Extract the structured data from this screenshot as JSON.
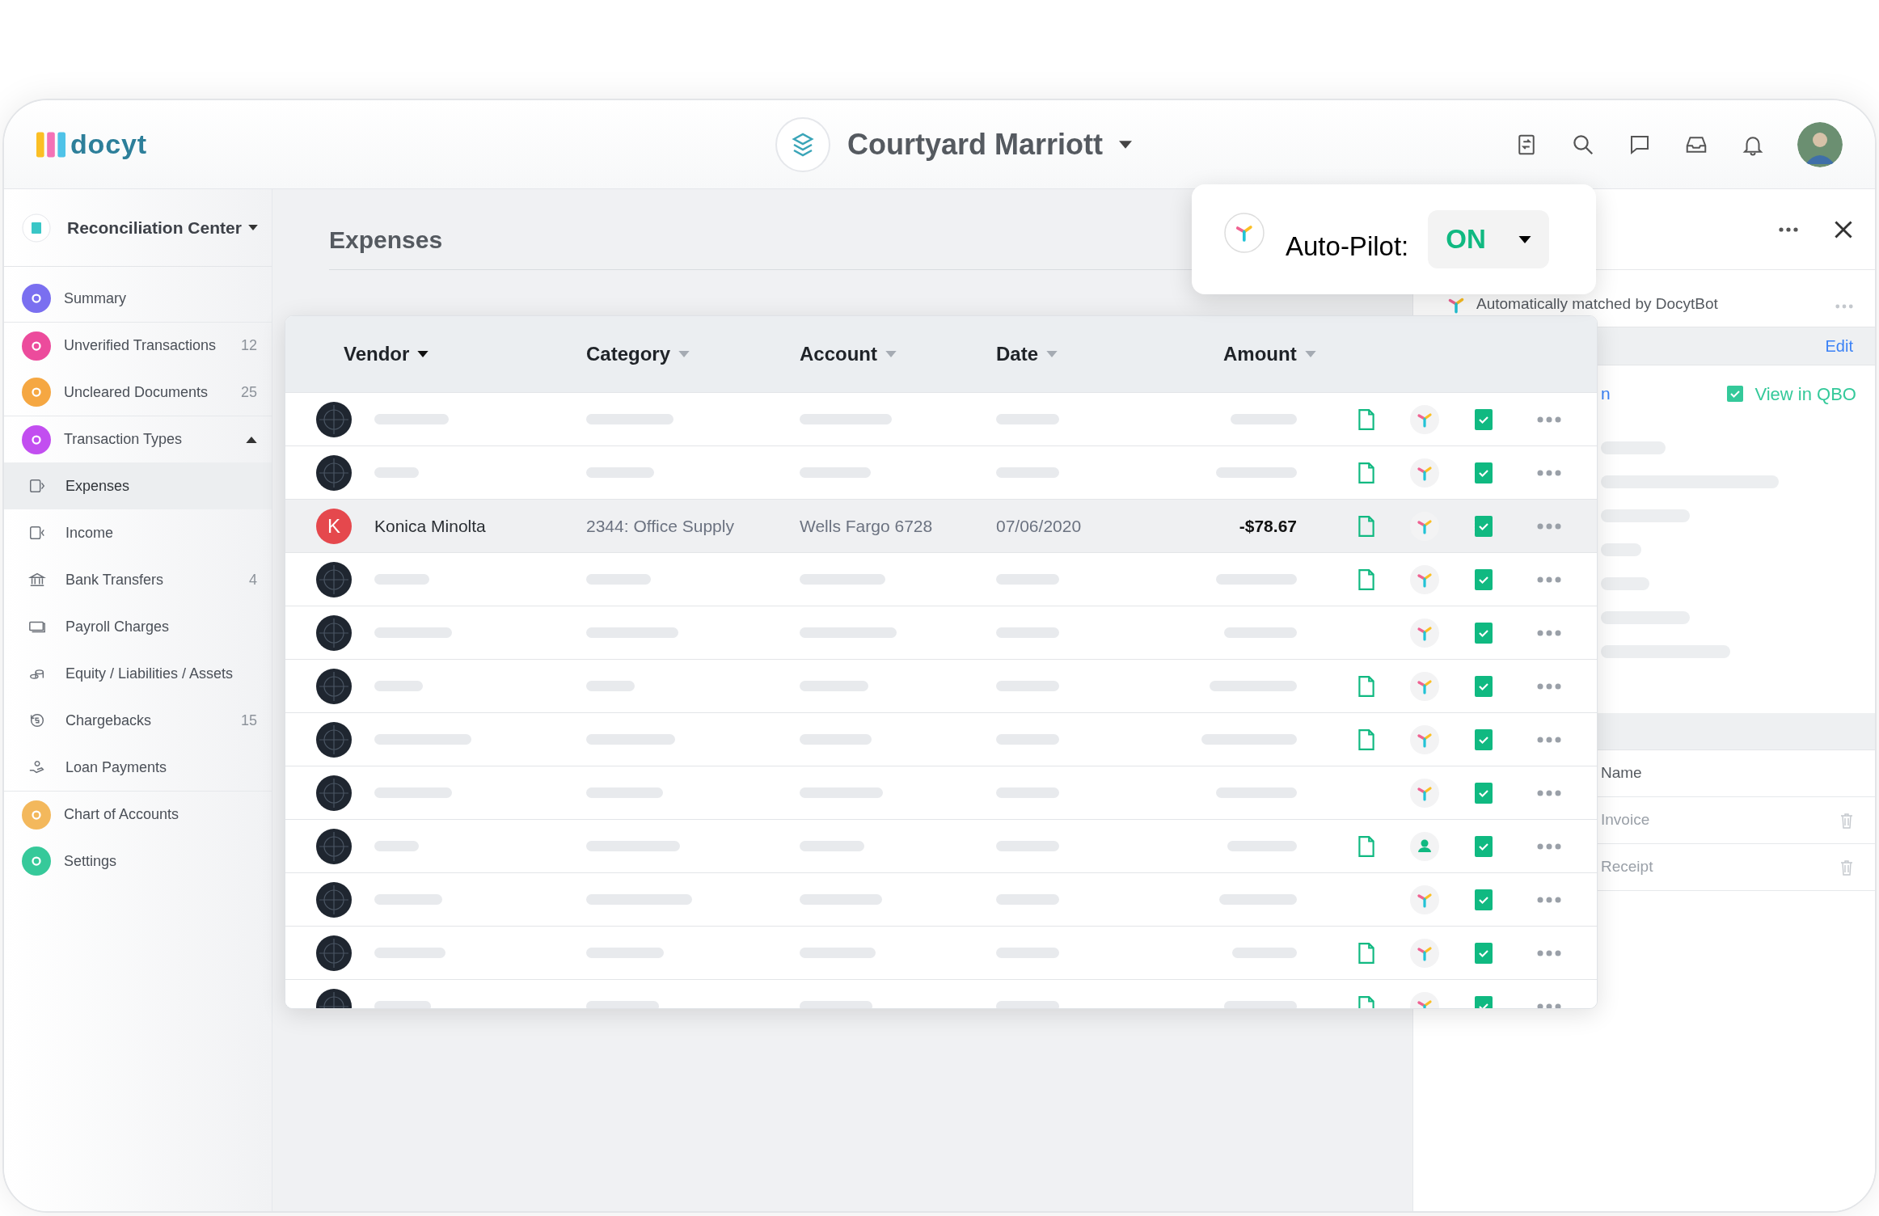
{
  "header": {
    "logo": "docyt",
    "business": "Courtyard Marriott"
  },
  "sidebar": {
    "title": "Reconciliation Center",
    "items": [
      {
        "label": "Summary",
        "color": "#7a6ff0"
      },
      {
        "label": "Unverified Transactions",
        "color": "#ec4b9c",
        "count": "12"
      },
      {
        "label": "Uncleared Documents",
        "color": "#f5a742",
        "count": "25"
      },
      {
        "label": "Transaction Types",
        "color": "#c24ef0",
        "expanded": true,
        "children": [
          {
            "label": "Expenses",
            "selected": true
          },
          {
            "label": "Income",
            "selected": false
          },
          {
            "label": "Bank Transfers",
            "selected": false,
            "count": "4"
          },
          {
            "label": "Payroll Charges",
            "selected": false
          },
          {
            "label": "Equity / Liabilities / Assets",
            "selected": false
          },
          {
            "label": "Chargebacks",
            "selected": false,
            "count": "15"
          },
          {
            "label": "Loan Payments",
            "selected": false
          }
        ]
      },
      {
        "label": "Chart of Accounts",
        "color": "#f3b85c"
      },
      {
        "label": "Settings",
        "color": "#36c99a"
      }
    ]
  },
  "page_title": "Expenses",
  "autopilot": {
    "label": "Auto-Pilot:",
    "value": "ON"
  },
  "table": {
    "columns": [
      {
        "label": "Vendor",
        "sorted": true
      },
      {
        "label": "Category",
        "sorted": false
      },
      {
        "label": "Account",
        "sorted": false
      },
      {
        "label": "Date",
        "sorted": false
      },
      {
        "label": "Amount",
        "sorted": false
      }
    ],
    "rows": [
      {
        "kind": "placeholder",
        "selected": false,
        "document": true,
        "auto_matched": true,
        "verified": true
      },
      {
        "kind": "placeholder",
        "selected": false,
        "document": true,
        "auto_matched": true,
        "verified": true
      },
      {
        "kind": "entry",
        "selected": true,
        "initial": "K",
        "vendor": "Konica Minolta",
        "category": "2344: Office Supply",
        "account": "Wells Fargo 6728",
        "date": "07/06/2020",
        "amount": "-$78.67",
        "document": true,
        "auto_matched": true,
        "verified": true
      },
      {
        "kind": "placeholder",
        "selected": false,
        "document": true,
        "auto_matched": true,
        "verified": true
      },
      {
        "kind": "placeholder",
        "selected": false,
        "document": false,
        "auto_matched": true,
        "verified": true
      },
      {
        "kind": "placeholder",
        "selected": false,
        "document": true,
        "auto_matched": true,
        "verified": true
      },
      {
        "kind": "placeholder",
        "selected": false,
        "document": true,
        "auto_matched": true,
        "verified": true
      },
      {
        "kind": "placeholder",
        "selected": false,
        "document": false,
        "auto_matched": true,
        "verified": true
      },
      {
        "kind": "placeholder",
        "selected": false,
        "document": true,
        "auto_matched": false,
        "verified": true
      },
      {
        "kind": "placeholder",
        "selected": false,
        "document": false,
        "auto_matched": true,
        "verified": true
      },
      {
        "kind": "placeholder",
        "selected": false,
        "document": true,
        "auto_matched": true,
        "verified": true
      },
      {
        "kind": "placeholder",
        "selected": false,
        "document": true,
        "auto_matched": true,
        "verified": true
      }
    ]
  },
  "detail_panel": {
    "match_note": "Automatically matched by DocytBot",
    "edit": "Edit",
    "partial_label": "n",
    "qbo_link": "View in QBO",
    "name_header": "Name",
    "documents": [
      "Invoice",
      "Receipt"
    ]
  }
}
